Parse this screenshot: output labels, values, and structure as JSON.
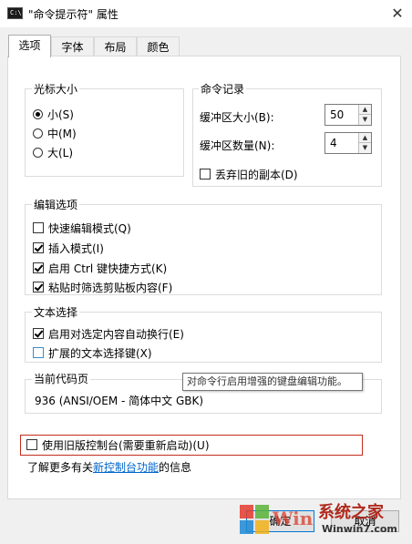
{
  "window": {
    "title": "\"命令提示符\" 属性",
    "icon_label": "C:\\"
  },
  "tabs": [
    {
      "label": "选项",
      "active": true
    },
    {
      "label": "字体",
      "active": false
    },
    {
      "label": "布局",
      "active": false
    },
    {
      "label": "颜色",
      "active": false
    }
  ],
  "cursor_size": {
    "legend": "光标大小",
    "options": [
      {
        "label": "小(S)",
        "selected": true
      },
      {
        "label": "中(M)",
        "selected": false
      },
      {
        "label": "大(L)",
        "selected": false
      }
    ]
  },
  "command_history": {
    "legend": "命令记录",
    "buffer_size_label": "缓冲区大小(B):",
    "buffer_size_value": "50",
    "buffer_count_label": "缓冲区数量(N):",
    "buffer_count_value": "4",
    "discard_dups_label": "丢弃旧的副本(D)",
    "discard_dups_checked": false
  },
  "edit_options": {
    "legend": "编辑选项",
    "items": [
      {
        "label": "快速编辑模式(Q)",
        "checked": false
      },
      {
        "label": "插入模式(I)",
        "checked": true
      },
      {
        "label": "启用 Ctrl 键快捷方式(K)",
        "checked": true
      },
      {
        "label": "粘贴时筛选剪贴板内容(F)",
        "checked": true
      }
    ]
  },
  "text_selection": {
    "legend": "文本选择",
    "items": [
      {
        "label": "启用对选定内容自动换行(E)",
        "checked": true
      },
      {
        "label": "扩展的文本选择键(X)",
        "checked": false
      }
    ]
  },
  "code_page": {
    "legend": "当前代码页",
    "value": "936   (ANSI/OEM - 简体中文 GBK)"
  },
  "tooltip": "对命令行启用增强的键盘编辑功能。",
  "legacy_console": {
    "label": "使用旧版控制台(需要重新启动)(U)",
    "checked": false
  },
  "learn_more": {
    "prefix": "了解更多有关",
    "link": "新控制台功能",
    "suffix": "的信息"
  },
  "buttons": {
    "ok": "确定",
    "cancel": "取消"
  },
  "watermark": {
    "brand": "系统之家",
    "url": "Winwin7.com"
  },
  "colors": {
    "accent_border": "#0078d7",
    "highlight_red": "#c42b1c",
    "link": "#0066cc"
  }
}
